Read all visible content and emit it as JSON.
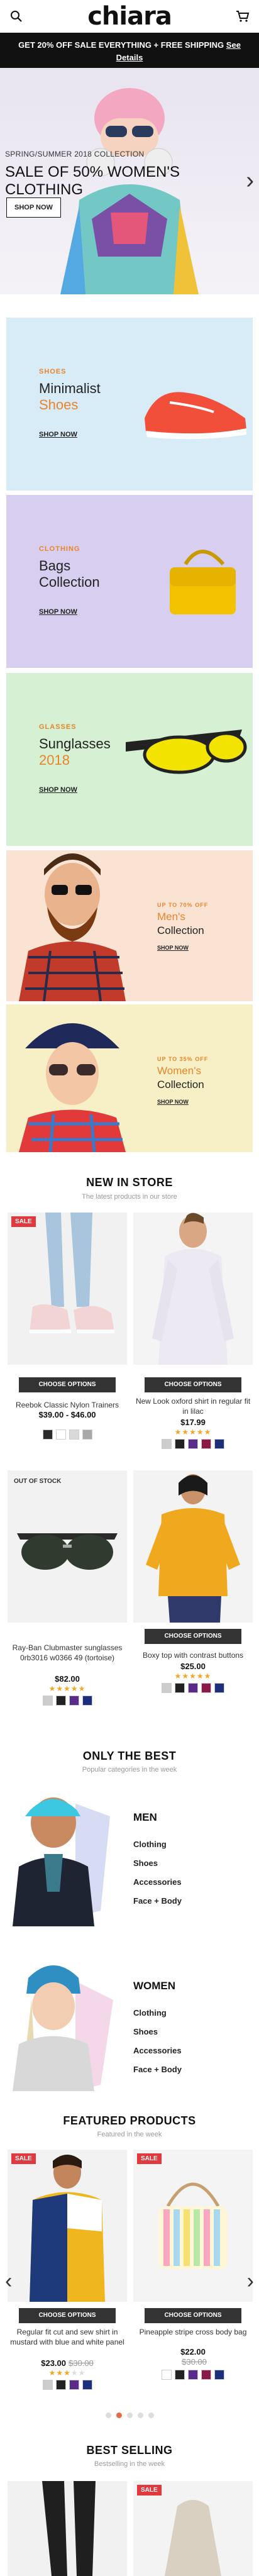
{
  "header": {
    "logo": "chiara",
    "promo_text": "GET 20% OFF SALE EVERYTHING + FREE SHIPPING",
    "promo_link": "See Details"
  },
  "hero": {
    "pretitle": "SPRING/SUMMER 2018 COLLECTION",
    "title": "SALE OF 50% WOMEN'S CLOTHING",
    "button": "SHOP NOW"
  },
  "banners": [
    {
      "eyebrow": "SHOES",
      "title1": "Minimalist",
      "title2": "Shoes",
      "cta": "SHOP NOW",
      "accent": "#e8852a",
      "bg": "#d7ecf7"
    },
    {
      "eyebrow": "CLOTHING",
      "title1": "Bags",
      "title2": "Collection",
      "cta": "SHOP NOW",
      "accent": "#e8852a",
      "bg": "#d8cff0"
    },
    {
      "eyebrow": "GLASSES",
      "title1": "Sunglasses",
      "title2": "2018",
      "cta": "SHOP NOW",
      "accent": "#e8852a",
      "bg": "#d6f0d3"
    },
    {
      "eyebrow": "UP TO 70% OFF",
      "title1": "Men's",
      "title2": "Collection",
      "cta": "SHOP NOW",
      "accent": "#e8852a",
      "bg": "#fbe3d4"
    },
    {
      "eyebrow": "UP TO 35% OFF",
      "title1": "Women's",
      "title2": "Collection",
      "cta": "SHOP NOW",
      "accent": "#e8852a",
      "bg": "#f7f0c6"
    }
  ],
  "new_in_store": {
    "title": "NEW IN STORE",
    "subtitle": "The latest products in our store",
    "choose_label": "CHOOSE OPTIONS",
    "products": [
      {
        "tag": "SALE",
        "name": "Reebok Classic Nylon Trainers",
        "price": "$39.00 - $46.00",
        "old_price": "",
        "rating": "",
        "swatches": [
          "#2b2b2b",
          "#ffffff",
          "#d9d9d9",
          "#a8a8a8"
        ]
      },
      {
        "tag": "",
        "name": "New Look oxford shirt in regular fit in lilac",
        "price": "$17.99",
        "old_price": "",
        "rating": "★★★★★",
        "swatches": [
          "#cccccc",
          "#222222",
          "#5a2b8a",
          "#8b1a4a",
          "#1d2e7a"
        ]
      },
      {
        "tag": "OUT OF STOCK",
        "name": "Ray-Ban Clubmaster sunglasses 0rb3016 w0366 49 (tortoise)",
        "price": "$82.00",
        "old_price": "",
        "rating": "★★★★★",
        "swatches": [
          "#cccccc",
          "#222222",
          "#5a2b8a",
          "#1d2e7a"
        ]
      },
      {
        "tag": "",
        "name": "Boxy top with contrast buttons",
        "price": "$25.00",
        "old_price": "",
        "rating": "★★★★★",
        "swatches": [
          "#cccccc",
          "#222222",
          "#5a2b8a",
          "#8b1a4a",
          "#1d2e7a"
        ]
      }
    ]
  },
  "only_best": {
    "title": "ONLY THE BEST",
    "subtitle": "Popular categories in the week",
    "categories": [
      {
        "name": "MEN",
        "items": [
          "Clothing",
          "Shoes",
          "Accessories",
          "Face + Body"
        ]
      },
      {
        "name": "WOMEN",
        "items": [
          "Clothing",
          "Shoes",
          "Accessories",
          "Face + Body"
        ]
      }
    ]
  },
  "featured": {
    "title": "FEATURED PRODUCTS",
    "subtitle": "Featured in the week",
    "choose_label": "CHOOSE OPTIONS",
    "products": [
      {
        "tag": "SALE",
        "name": "Regular fit cut and sew shirt in mustard with blue and white panel",
        "price": "$23.00",
        "old_price": "$30.00",
        "rating": "★★★",
        "swatches": [
          "#cccccc",
          "#222222",
          "#5a2b8a",
          "#1d2e7a"
        ]
      },
      {
        "tag": "SALE",
        "name": "Pineapple stripe cross body bag",
        "price": "$22.00",
        "old_price": "$30.00",
        "rating": "",
        "swatches": [
          "#ffffff",
          "#222222",
          "#5a2b8a",
          "#8b1a4a",
          "#1d2e7a"
        ]
      }
    ]
  },
  "best_selling": {
    "title": "BEST SELLING",
    "subtitle": "Bestselling in the week",
    "tag": "SALE"
  }
}
